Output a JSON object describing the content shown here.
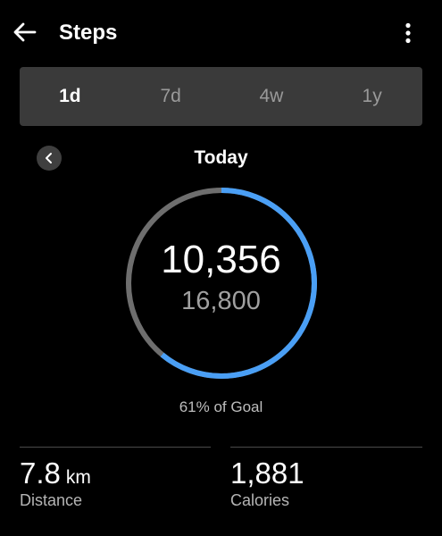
{
  "header": {
    "title": "Steps",
    "back_icon": "arrow-left-icon",
    "menu_icon": "more-vertical-icon"
  },
  "tabs": [
    {
      "label": "1d",
      "active": true
    },
    {
      "label": "7d",
      "active": false
    },
    {
      "label": "4w",
      "active": false
    },
    {
      "label": "1y",
      "active": false
    }
  ],
  "date_nav": {
    "label": "Today",
    "prev_icon": "chevron-left-icon"
  },
  "progress": {
    "steps": "10,356",
    "goal": "16,800",
    "percent_text": "61% of Goal",
    "fraction": 0.61,
    "colors": {
      "progress": "#4a9ff5",
      "track": "#6e6e6e"
    }
  },
  "stats": {
    "distance": {
      "value": "7.8",
      "unit": "km",
      "label": "Distance"
    },
    "calories": {
      "value": "1,881",
      "label": "Calories"
    }
  }
}
